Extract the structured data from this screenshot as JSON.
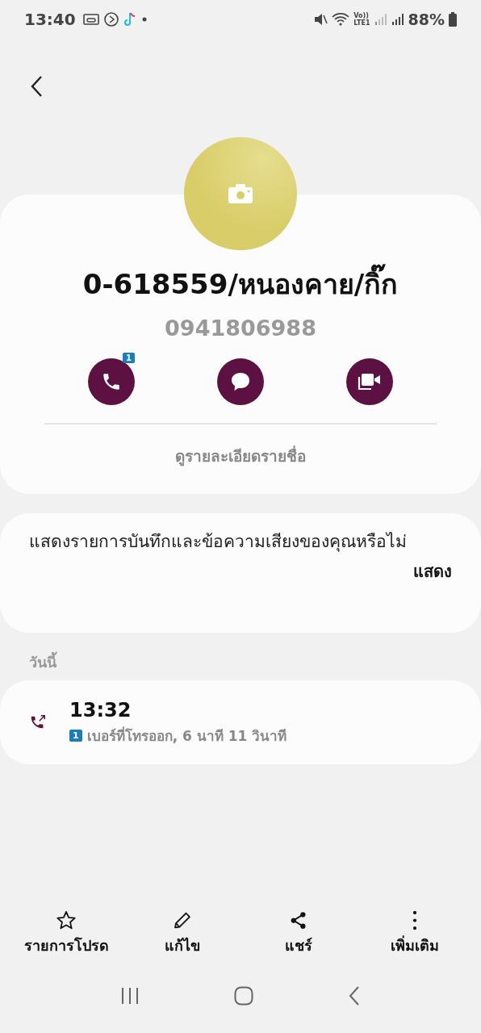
{
  "status_bar": {
    "time": "13:40",
    "volte": "Vo))",
    "lte": "LTE1",
    "battery": "88%"
  },
  "contact": {
    "name": "0-618559/หนองคาย/กิ๊ก",
    "phone": "0941806988",
    "actions": [
      {
        "kind": "call",
        "badge": "1"
      },
      {
        "kind": "message"
      },
      {
        "kind": "video"
      }
    ],
    "details_link": "ดูรายละเอียดรายชื่อ"
  },
  "prompt": {
    "text": "แสดงรายการบันทึกและข้อความเสียงของคุณหรือไม่",
    "button": "แสดง"
  },
  "log": {
    "heading": "วันนี้",
    "entries": [
      {
        "time": "13:32",
        "sim": "1",
        "detail": "เบอร์ที่โทรออก, 6 นาที 11 วินาที"
      }
    ]
  },
  "toolbar": [
    {
      "kind": "star",
      "label": "รายการโปรด"
    },
    {
      "kind": "edit",
      "label": "แก้ไข"
    },
    {
      "kind": "share",
      "label": "แชร์"
    },
    {
      "kind": "more",
      "label": "เพิ่มเติม"
    }
  ]
}
